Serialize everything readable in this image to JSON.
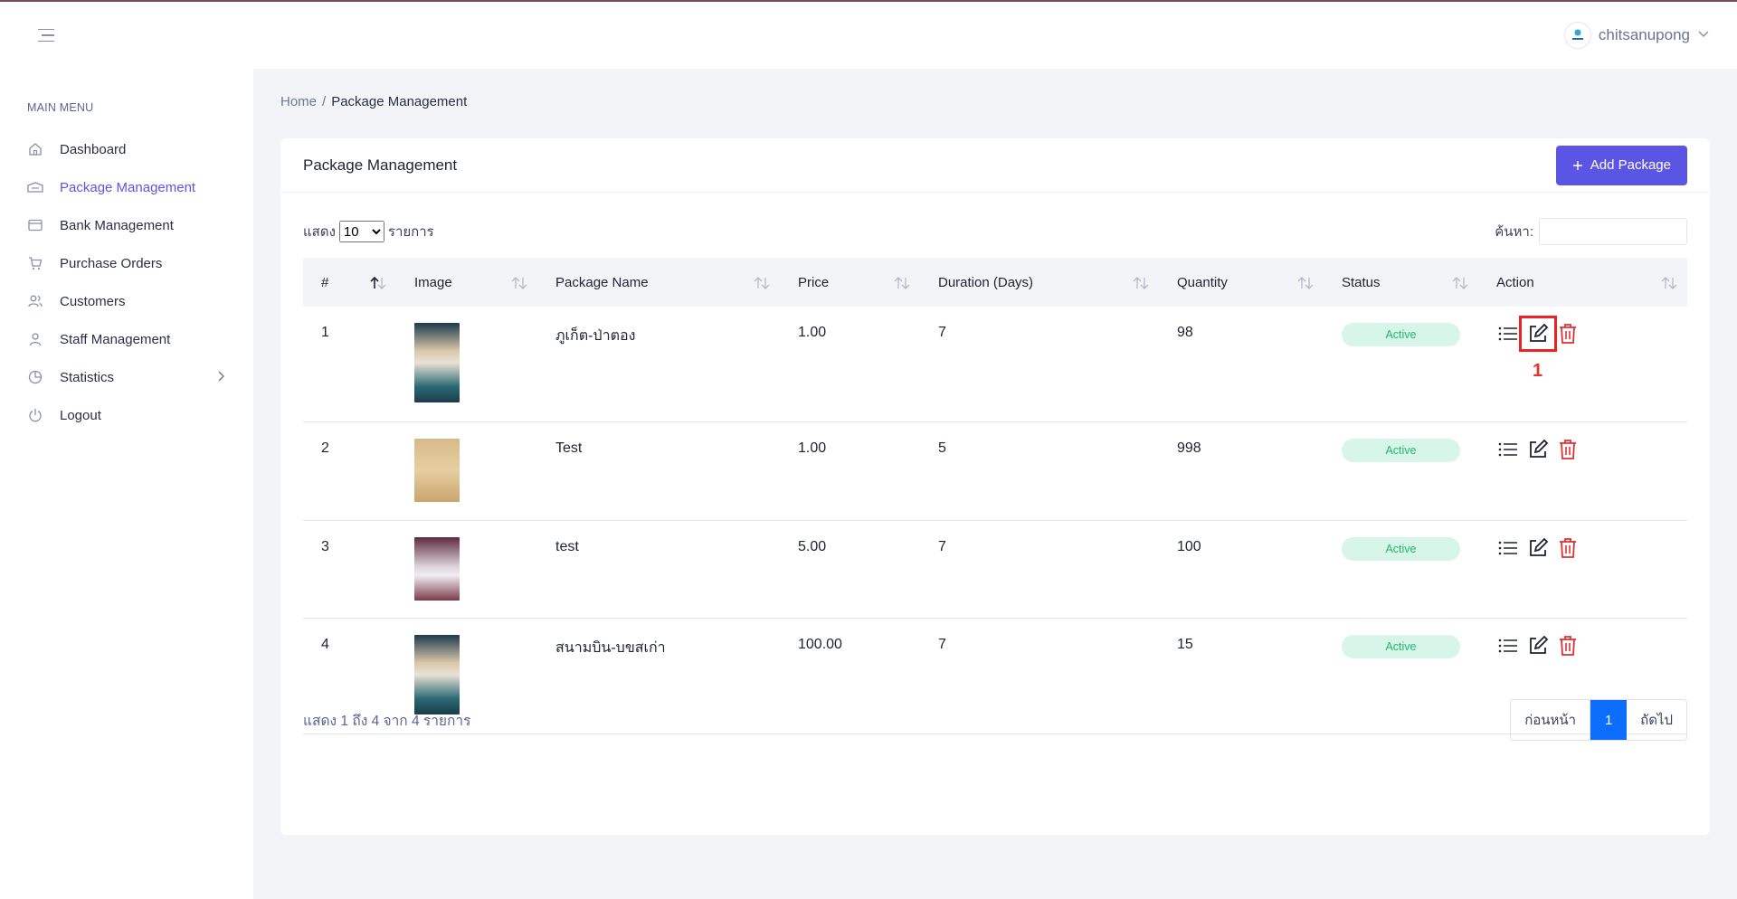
{
  "header": {
    "username": "chitsanupong"
  },
  "sidebar": {
    "heading": "MAIN MENU",
    "items": [
      {
        "label": "Dashboard",
        "icon": "home-icon"
      },
      {
        "label": "Package Management",
        "icon": "package-icon",
        "active": true
      },
      {
        "label": "Bank Management",
        "icon": "credit-card-icon"
      },
      {
        "label": "Purchase Orders",
        "icon": "cart-icon"
      },
      {
        "label": "Customers",
        "icon": "users-icon"
      },
      {
        "label": "Staff Management",
        "icon": "user-icon"
      },
      {
        "label": "Statistics",
        "icon": "pie-chart-icon"
      },
      {
        "label": "Logout",
        "icon": "power-icon"
      }
    ]
  },
  "breadcrumb": {
    "home": "Home",
    "separator": "/",
    "current": "Package Management"
  },
  "card": {
    "title": "Package Management",
    "add_button": "Add Package"
  },
  "controls": {
    "show_prefix": "แสดง",
    "page_length": "10",
    "show_suffix": "รายการ",
    "search_label": "ค้นหา:"
  },
  "table": {
    "columns": [
      "#",
      "Image",
      "Package Name",
      "Price",
      "Duration (Days)",
      "Quantity",
      "Status",
      "Action"
    ],
    "rows": [
      {
        "no": "1",
        "name": "ภูเก็ต-ป่าตอง",
        "price": "1.00",
        "duration": "7",
        "quantity": "98",
        "status": "Active"
      },
      {
        "no": "2",
        "name": "Test",
        "price": "1.00",
        "duration": "5",
        "quantity": "998",
        "status": "Active"
      },
      {
        "no": "3",
        "name": "test",
        "price": "5.00",
        "duration": "7",
        "quantity": "100",
        "status": "Active"
      },
      {
        "no": "4",
        "name": "สนามบิน-บขสเก่า",
        "price": "100.00",
        "duration": "7",
        "quantity": "15",
        "status": "Active"
      }
    ]
  },
  "annotation": {
    "label": "1"
  },
  "footer": {
    "info": "แสดง 1 ถึง 4 จาก 4 รายการ",
    "prev": "ก่อนหน้า",
    "current_page": "1",
    "next": "ถัดไป"
  },
  "colors": {
    "accent": "#5b55e6",
    "active_badge_bg": "#d8f5e9",
    "active_badge_text": "#1fb86b",
    "delete": "#e03131",
    "highlight": "#ee2222",
    "page_current": "#0d6efd"
  }
}
